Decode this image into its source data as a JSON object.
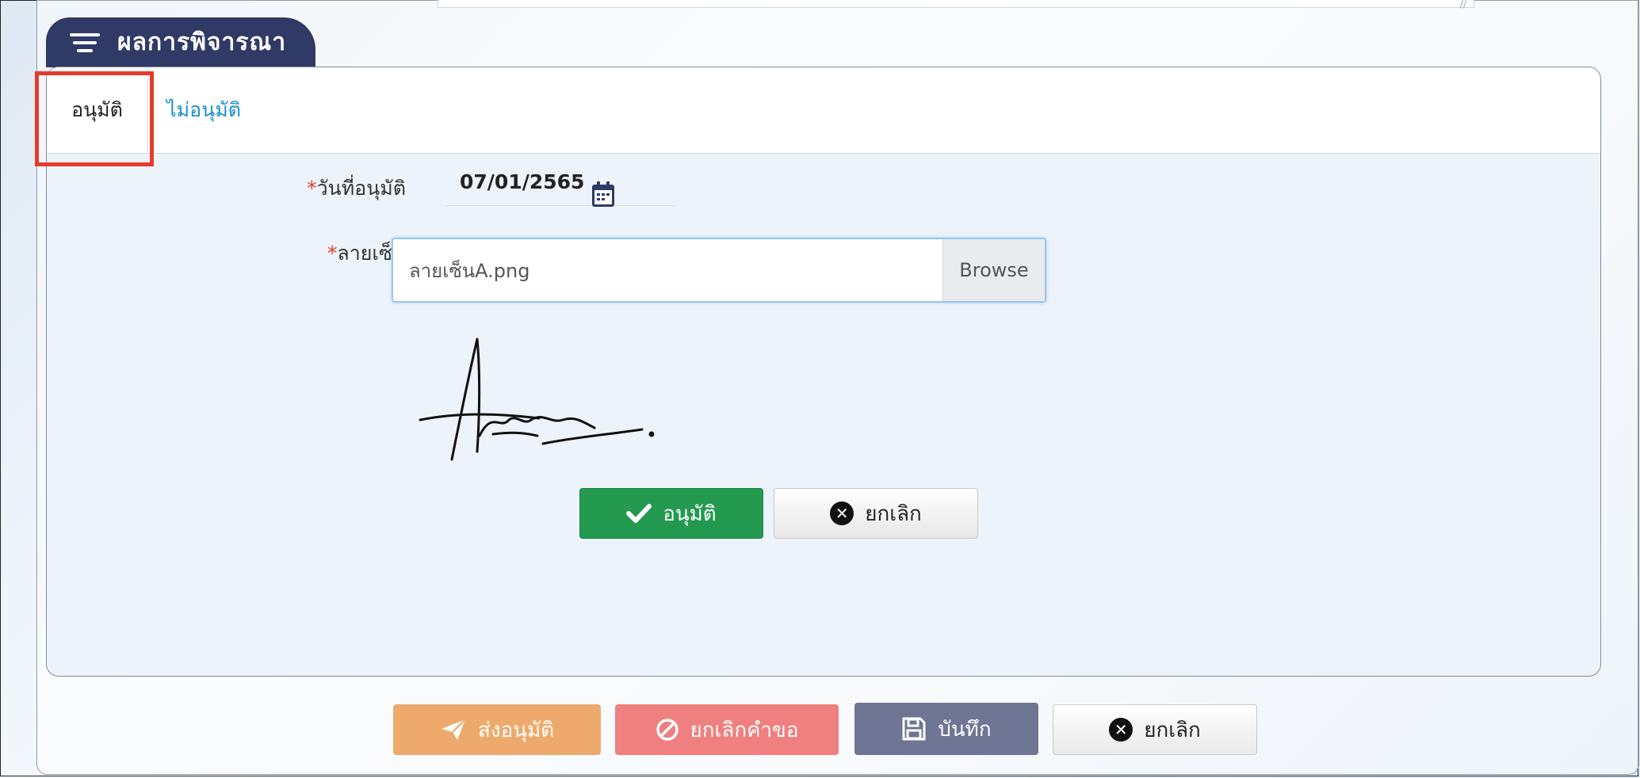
{
  "section": {
    "title": "ผลการพิจารณา"
  },
  "tabs": [
    {
      "label": "อนุมัติ",
      "active": true
    },
    {
      "label": "ไม่อนุมัติ",
      "active": false
    }
  ],
  "form": {
    "approve_date": {
      "required_mark": "*",
      "label": "วันที่อนุมัติ",
      "value": "07/01/2565"
    },
    "signature": {
      "required_mark": "*",
      "label": "ลายเซ็น",
      "file_name": "ลายเซ็นA.png",
      "browse_label": "Browse"
    }
  },
  "inner_buttons": {
    "approve_label": "อนุมัติ",
    "cancel_label": "ยกเลิก"
  },
  "bottom_buttons": {
    "send_label": "ส่งอนุมัติ",
    "cancel_request_label": "ยกเลิกคำขอ",
    "save_label": "บันทึก",
    "cancel_label": "ยกเลิก"
  },
  "colors": {
    "header_bg": "#2f3a66",
    "highlight": "#e53b2c",
    "approve": "#239a4f",
    "send": "#eeaa6c",
    "cancel_request": "#f07f7f",
    "save": "#6f7594",
    "tab_link": "#1a8fd1"
  }
}
